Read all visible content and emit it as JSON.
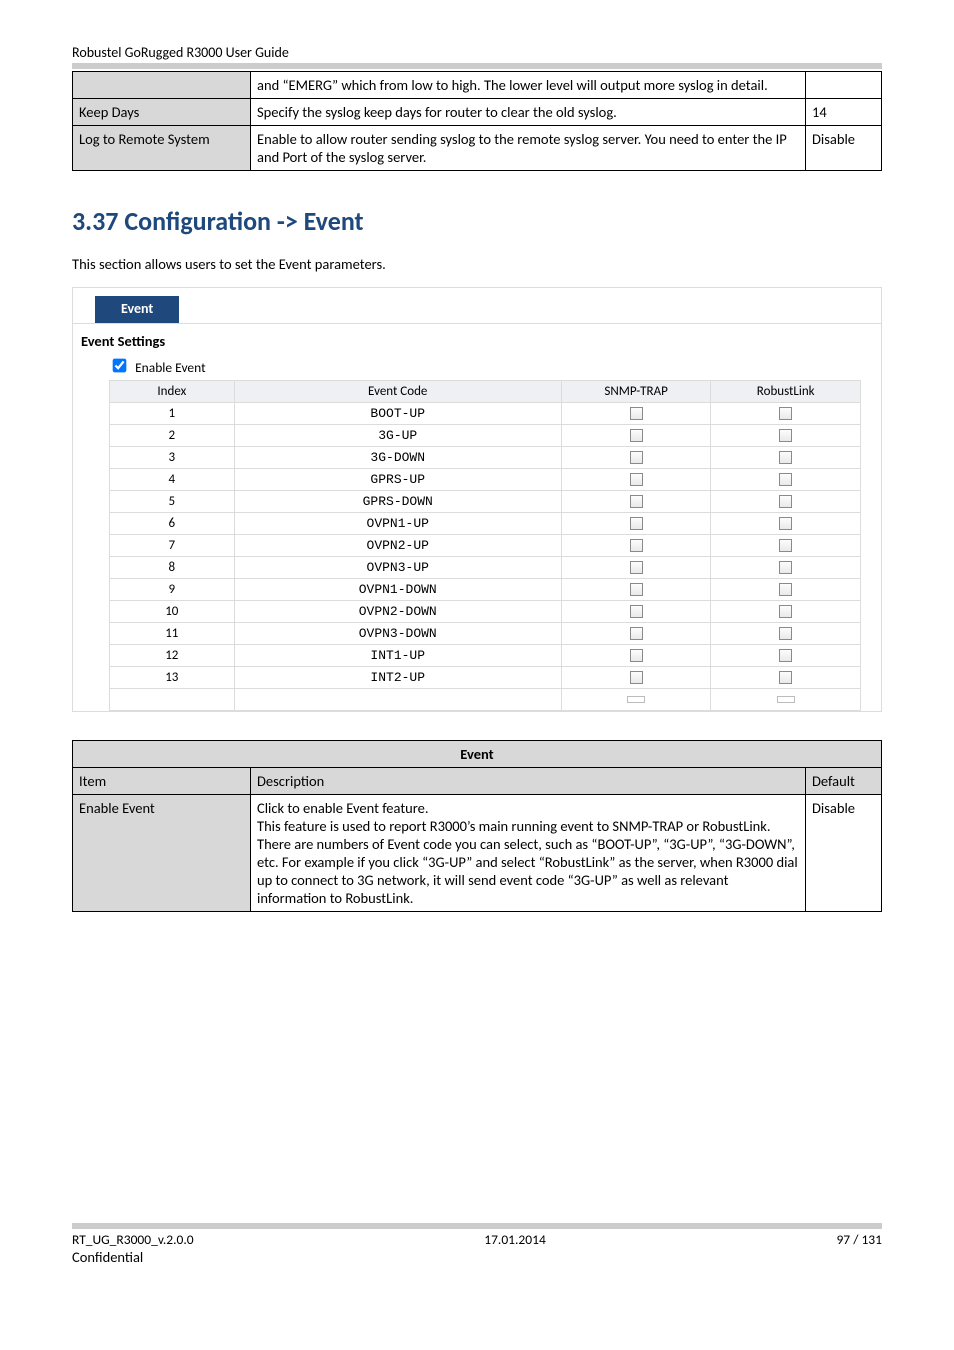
{
  "page": {
    "running_head": "Robustel GoRugged R3000 User Guide",
    "footer_left": "RT_UG_R3000_v.2.0.0",
    "footer_center": "17.01.2014",
    "footer_right": "97 / 131",
    "confidential": "Confidential"
  },
  "spec_table": {
    "rows": [
      {
        "label": "",
        "desc": "and “EMERG” which from low to high. The lower level will output more syslog in detail.",
        "val": ""
      },
      {
        "label": "Keep Days",
        "desc": "Specify the syslog keep days for router to clear the old syslog.",
        "val": "14"
      },
      {
        "label": "Log to Remote System",
        "desc": "Enable to allow router sending syslog to the remote syslog server. You need to enter the IP and Port of the syslog server.",
        "val": "Disable"
      }
    ]
  },
  "section": {
    "title": "3.37  Configuration -> Event",
    "lead": "This section allows users to set the Event parameters."
  },
  "event_panel": {
    "tab": "Event",
    "settings_hd": "Event Settings",
    "enable_label": "Enable Event",
    "headers": {
      "index": "Index",
      "code": "Event Code",
      "snmp": "SNMP-TRAP",
      "robust": "RobustLink"
    },
    "rows": [
      {
        "idx": "1",
        "code": "BOOT-UP"
      },
      {
        "idx": "2",
        "code": "3G-UP"
      },
      {
        "idx": "3",
        "code": "3G-DOWN"
      },
      {
        "idx": "4",
        "code": "GPRS-UP"
      },
      {
        "idx": "5",
        "code": "GPRS-DOWN"
      },
      {
        "idx": "6",
        "code": "OVPN1-UP"
      },
      {
        "idx": "7",
        "code": "OVPN2-UP"
      },
      {
        "idx": "8",
        "code": "OVPN3-UP"
      },
      {
        "idx": "9",
        "code": "OVPN1-DOWN"
      },
      {
        "idx": "10",
        "code": "OVPN2-DOWN"
      },
      {
        "idx": "11",
        "code": "OVPN3-DOWN"
      },
      {
        "idx": "12",
        "code": "INT1-UP"
      },
      {
        "idx": "13",
        "code": "INT2-UP"
      }
    ]
  },
  "event_table": {
    "title": "Event",
    "item_hd": "Item",
    "desc_hd": "Description",
    "def_hd": "Default",
    "row": {
      "item": "Enable Event",
      "desc": "Click to enable Event feature.\nThis feature is used to report R3000’s main running event to SNMP-TRAP or RobustLink. There are numbers of Event code you can select, such as “BOOT-UP”, “3G-UP”, “3G-DOWN”, etc. For example if you click “3G-UP” and select “RobustLink” as the server, when R3000 dial up to connect to 3G network, it will send event code “3G-UP” as well as relevant information to RobustLink.",
      "def": "Disable"
    }
  }
}
